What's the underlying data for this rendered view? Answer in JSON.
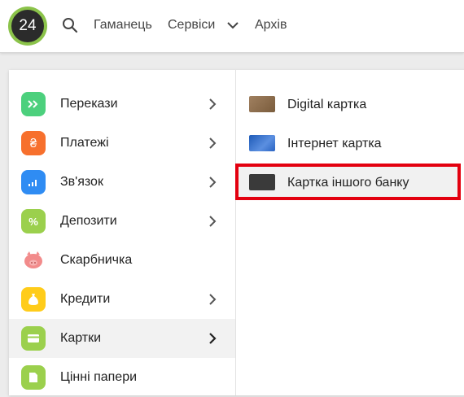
{
  "header": {
    "logo_text": "24",
    "nav": [
      "Гаманець",
      "Сервіси",
      "Архів"
    ]
  },
  "menu": {
    "items": [
      {
        "label": "Перекази",
        "icon": "transfers-icon",
        "color": "#4cd07d",
        "has_submenu": true
      },
      {
        "label": "Платежі",
        "icon": "payments-icon",
        "color": "#f7702d",
        "has_submenu": true
      },
      {
        "label": "Зв'язок",
        "icon": "connection-icon",
        "color": "#2f8cf3",
        "has_submenu": true
      },
      {
        "label": "Депозити",
        "icon": "deposits-icon",
        "color": "#9bd04d",
        "has_submenu": true
      },
      {
        "label": "Скарбничка",
        "icon": "piggy-bank-icon",
        "color": "#f28b8b",
        "has_submenu": false
      },
      {
        "label": "Кредити",
        "icon": "credits-icon",
        "color": "#ffcc1a",
        "has_submenu": true
      },
      {
        "label": "Картки",
        "icon": "cards-icon",
        "color": "#9bd04d",
        "has_submenu": true,
        "active": true
      },
      {
        "label": "Цінні папери",
        "icon": "securities-icon",
        "color": "#9bd04d",
        "has_submenu": false
      }
    ],
    "submenu": [
      {
        "label": "Digital картка",
        "icon": "digital-card-icon"
      },
      {
        "label": "Інтернет картка",
        "icon": "internet-card-icon"
      },
      {
        "label": "Картка іншого банку",
        "icon": "other-bank-card-icon",
        "highlighted": true
      }
    ]
  },
  "colors": {
    "brand_green": "#8bc34a",
    "highlight_red": "#e3000f"
  }
}
